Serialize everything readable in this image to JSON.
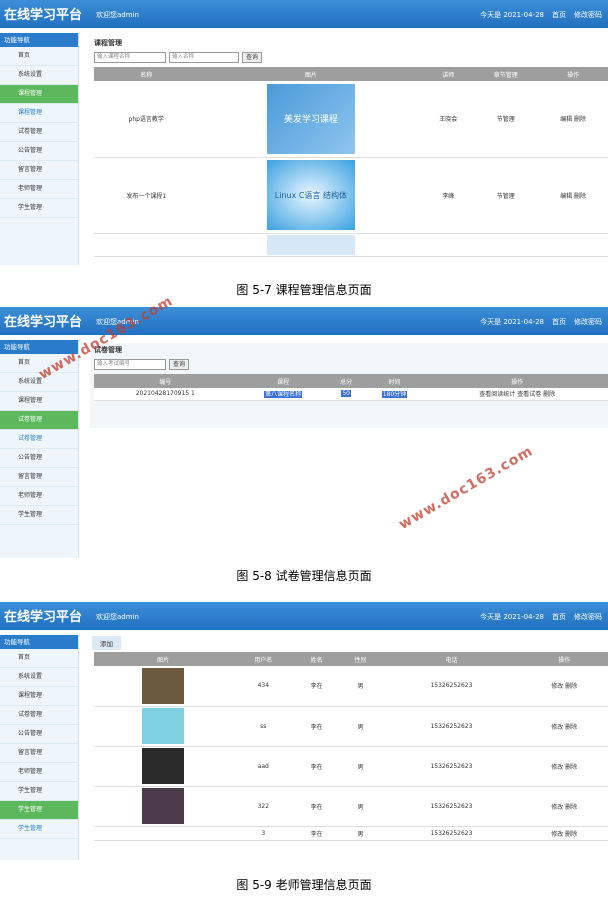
{
  "app": {
    "title": "在线学习平台",
    "welcome": "欢迎您admin",
    "date": "今天是 2021-04-28",
    "home": "首页",
    "change_pwd": "修改密码"
  },
  "sidebar_head": "功能导航",
  "panel1": {
    "sidebar": [
      "首页",
      "系统设置",
      "课程管理",
      "课程管理",
      "试卷管理",
      "公告管理",
      "留言管理",
      "老师管理",
      "学生管理"
    ],
    "crumb": "课程管理",
    "search_ph1": "输入课程名称",
    "search_ph2": "输入名称",
    "search_btn": "查询",
    "headers": [
      "名称",
      "图片",
      "讲师",
      "章节管理",
      "操作"
    ],
    "rows": [
      {
        "name": "php语言教学",
        "cover": "美发学习课程",
        "teacher": "王晓会",
        "chapter": "节管理",
        "ops": "编辑 删除"
      },
      {
        "name": "发布一个课程1",
        "cover": "Linux C语言 结构体",
        "teacher": "李峰",
        "chapter": "节管理",
        "ops": "编辑 删除"
      }
    ],
    "caption": "图 5-7 课程管理信息页面"
  },
  "panel2": {
    "sidebar": [
      "首页",
      "系统设置",
      "课程管理",
      "试卷管理",
      "试卷管理",
      "公告管理",
      "留言管理",
      "老师管理",
      "学生管理"
    ],
    "crumb": "试卷管理",
    "search_ph": "输入考试编号",
    "search_btn": "查询",
    "headers": [
      "编号",
      "课程",
      "总分",
      "时间",
      "操作"
    ],
    "row": {
      "id": "20210428170915 1",
      "course": "第八课程名称",
      "score": "50",
      "time": "180分钟",
      "ops1": "查看阅读统计",
      "ops2": "查看试卷",
      "ops3": "删除"
    },
    "caption": "图 5-8 试卷管理信息页面"
  },
  "panel3": {
    "sidebar": [
      "首页",
      "系统设置",
      "课程管理",
      "试卷管理",
      "公告管理",
      "留言管理",
      "老师管理",
      "学生管理",
      "学生管理",
      "学生管理"
    ],
    "add": "添加",
    "headers": [
      "图片",
      "用户名",
      "姓名",
      "性别",
      "电话",
      "操作"
    ],
    "rows": [
      {
        "user": "434",
        "name": "李在",
        "gender": "男",
        "phone": "15326252623",
        "ops": "修改 删除"
      },
      {
        "user": "ss",
        "name": "李在",
        "gender": "男",
        "phone": "15326252623",
        "ops": "修改 删除"
      },
      {
        "user": "aad",
        "name": "李在",
        "gender": "男",
        "phone": "15326252623",
        "ops": "修改 删除"
      },
      {
        "user": "322",
        "name": "李在",
        "gender": "男",
        "phone": "15326252623",
        "ops": "修改 删除"
      },
      {
        "user": "3",
        "name": "李在",
        "gender": "男",
        "phone": "15326252623",
        "ops": "修改 删除"
      }
    ],
    "caption": "图 5-9 老师管理信息页面"
  },
  "watermark": "www.doc163.com"
}
